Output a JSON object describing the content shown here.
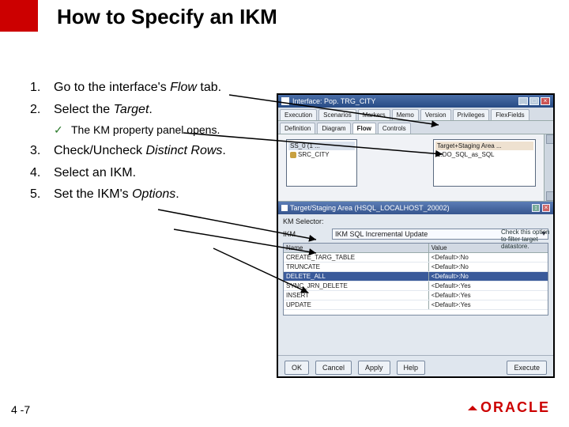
{
  "slide": {
    "title": "How to Specify an IKM",
    "page_number": "4 -7",
    "brand": "ORACLE"
  },
  "steps": {
    "s1": {
      "num": "1.",
      "text": "Go to the interface's Flow tab."
    },
    "s2": {
      "num": "2.",
      "text": "Select the Target."
    },
    "sub": {
      "mark": "✓",
      "text": "The KM property panel opens."
    },
    "s3": {
      "num": "3.",
      "text": "Check/Uncheck Distinct Rows."
    },
    "s4": {
      "num": "4.",
      "text": "Select an IKM."
    },
    "s5": {
      "num": "5.",
      "text": "Set the IKM's Options."
    }
  },
  "app": {
    "window_title": "Interface: Pop. TRG_CITY",
    "window_controls": {
      "min": "_",
      "max": "□",
      "close": "×"
    },
    "tabs_row1": [
      "Execution",
      "Scenarios",
      "Markers",
      "Memo",
      "Version",
      "Privileges",
      "FlexFields"
    ],
    "tabs_row2": [
      "Definition",
      "Diagram",
      "Flow",
      "Controls"
    ],
    "active_tab": "Flow",
    "source_header": "SS_0 (1 ...",
    "source_row1": "SRC_CITY",
    "source_row2": "",
    "target_header": "Target+Staging Area ...",
    "target_row1": "1:DO_SQL_as_SQL",
    "panel_title": "Target/Staging Area (HSQL_LOCALHOST_20002)",
    "selector_label": "KM Selector:",
    "ikm_label": "IKM",
    "ikm_value": "IKM SQL Incremental Update",
    "side_note": "Check this option to filter target datastore.",
    "grid_header": {
      "col1": "Name",
      "col2": "Value"
    },
    "grid_rows": [
      {
        "name": "CREATE_TARG_TABLE",
        "value": "<Default>:No"
      },
      {
        "name": "TRUNCATE",
        "value": "<Default>:No"
      },
      {
        "name": "DELETE_ALL",
        "value": "<Default>:No",
        "hl": true
      },
      {
        "name": "SYNC_JRN_DELETE",
        "value": "<Default>:Yes"
      },
      {
        "name": "INSERT",
        "value": "<Default>:Yes"
      },
      {
        "name": "UPDATE",
        "value": "<Default>:Yes"
      }
    ],
    "buttons": {
      "ok": "OK",
      "cancel": "Cancel",
      "apply": "Apply",
      "help": "Help",
      "execute": "Execute"
    }
  }
}
